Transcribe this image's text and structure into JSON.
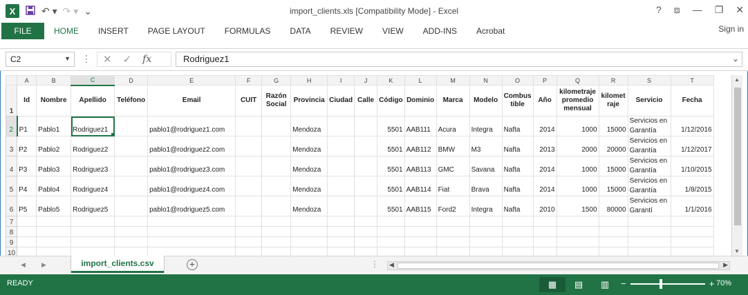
{
  "window": {
    "title": "import_clients.xls  [Compatibility Mode] - Excel",
    "app_icon": "X",
    "controls": [
      "?",
      "⧈",
      "—",
      "❐",
      "✕"
    ]
  },
  "ribbon": {
    "tabs": [
      "FILE",
      "HOME",
      "INSERT",
      "PAGE LAYOUT",
      "FORMULAS",
      "DATA",
      "REVIEW",
      "VIEW",
      "ADD-INS",
      "Acrobat"
    ],
    "active_tab": "HOME",
    "signin": "Sign in"
  },
  "formula_bar": {
    "name_box": "C2",
    "fx_label": "fx",
    "content": "Rodriguez1"
  },
  "grid": {
    "columns": [
      "A",
      "B",
      "C",
      "D",
      "E",
      "F",
      "G",
      "H",
      "I",
      "J",
      "K",
      "L",
      "M",
      "N",
      "O",
      "P",
      "Q",
      "R",
      "S",
      "T"
    ],
    "selected_column": "C",
    "headers": [
      "Id",
      "Nombre",
      "Apellido",
      "Teléfono",
      "Email",
      "CUIT",
      "Razón Social",
      "Provincia",
      "Ciudad",
      "Calle",
      "Código",
      "Dominio",
      "Marca",
      "Modelo",
      "Combus tible",
      "Año",
      "kilometraje promedio mensual",
      "kilomet raje",
      "Servicio",
      "Fecha"
    ],
    "rows": [
      [
        "P1",
        "Pablo1",
        "Rodriguez1",
        "",
        "pablo1@rodriguez1.com",
        "",
        "",
        "Mendoza",
        "",
        "",
        "5501",
        "AAB111",
        "Acura",
        "Integra",
        "Nafta",
        "2014",
        "1000",
        "15000",
        "Servicios en Garantía",
        "1/12/2016"
      ],
      [
        "P2",
        "Pablo2",
        "Rodriguez2",
        "",
        "pablo1@rodriguez2.com",
        "",
        "",
        "Mendoza",
        "",
        "",
        "5501",
        "AAB112",
        "BMW",
        "M3",
        "Nafta",
        "2013",
        "2000",
        "20000",
        "Servicios en Garantía",
        "1/12/2017"
      ],
      [
        "P3",
        "Pablo3",
        "Rodriguez3",
        "",
        "pablo1@rodriguez3.com",
        "",
        "",
        "Mendoza",
        "",
        "",
        "5501",
        "AAB113",
        "GMC",
        "Savana",
        "Nafta",
        "2014",
        "1000",
        "15000",
        "Servicios en Garantía",
        "1/10/2015"
      ],
      [
        "P4",
        "Pablo4",
        "Rodriguez4",
        "",
        "pablo1@rodriguez4.com",
        "",
        "",
        "Mendoza",
        "",
        "",
        "5501",
        "AAB114",
        "Fiat",
        "Brava",
        "Nafta",
        "2014",
        "1000",
        "15000",
        "Servicios en Garantía",
        "1/8/2015"
      ],
      [
        "P5",
        "Pablo5",
        "Rodriguez5",
        "",
        "pablo1@rodriguez5.com",
        "",
        "",
        "Mendoza",
        "",
        "",
        "5501",
        "AAB115",
        "Ford2",
        "Integra",
        "Nafta",
        "2010",
        "1500",
        "80000",
        "Servicios en Garantí",
        "1/1/2016"
      ]
    ],
    "row_numbers": [
      "1",
      "2",
      "3",
      "4",
      "5",
      "6",
      "7",
      "8",
      "9",
      "10"
    ],
    "selected_row": "2"
  },
  "sheets": {
    "tabs": [
      "import_clients.csv"
    ],
    "add_label": "+"
  },
  "status": {
    "text": "READY",
    "zoom_minus": "−",
    "zoom_plus": "+",
    "zoom_level": "70%"
  },
  "colors": {
    "accent": "#217346"
  }
}
